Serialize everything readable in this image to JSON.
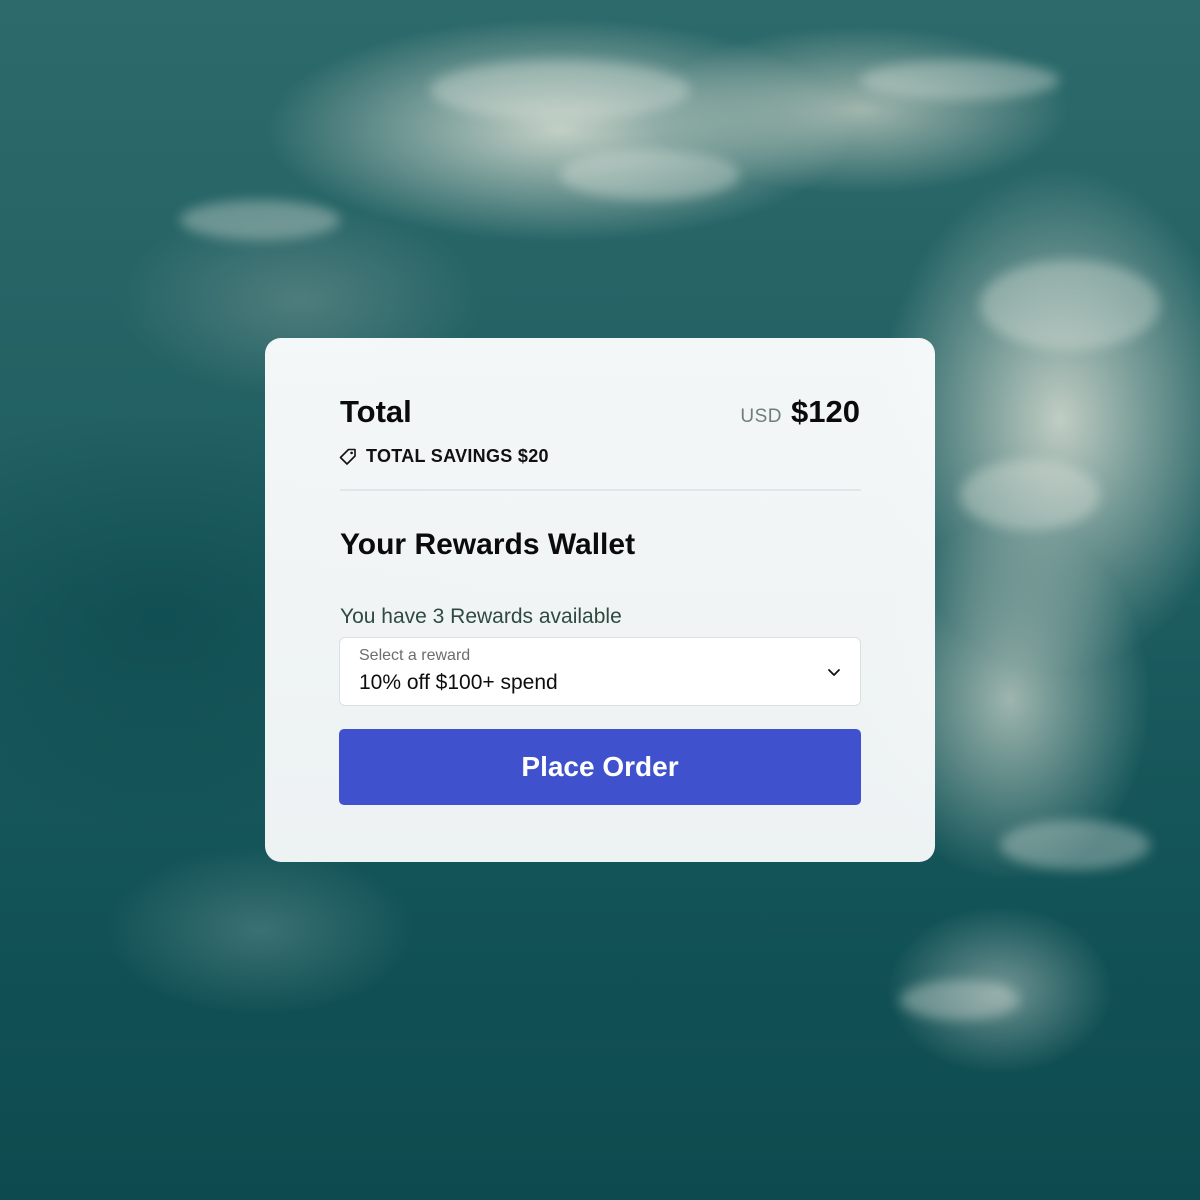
{
  "summary": {
    "total_label": "Total",
    "currency": "USD",
    "amount": "$120",
    "savings_text": "TOTAL SAVINGS $20"
  },
  "wallet": {
    "title": "Your Rewards Wallet",
    "rewards_available_text": "You have 3 Rewards available",
    "select": {
      "label": "Select a reward",
      "selected_value": "10% off $100+ spend"
    }
  },
  "actions": {
    "place_order_label": "Place Order"
  },
  "icons": {
    "savings": "tag-icon",
    "select": "chevron-down-icon"
  },
  "colors": {
    "primary_button": "#3f51cc",
    "card_background": "#f6f8f9",
    "currency_text": "#6f7f76",
    "rewards_text": "#2f4a3f"
  }
}
